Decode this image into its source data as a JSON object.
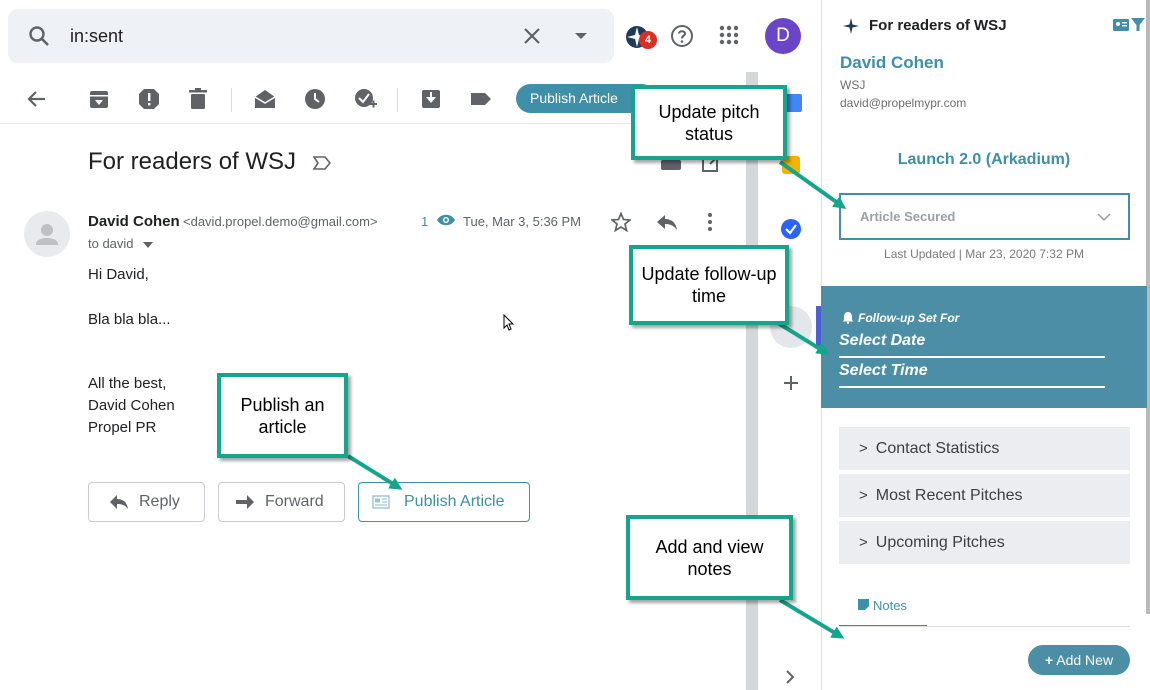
{
  "search": {
    "query": "in:sent"
  },
  "header": {
    "avatar_letter": "D",
    "notification_count": "4"
  },
  "toolbar": {
    "publish_label": "Publish Article"
  },
  "email": {
    "subject": "For readers of WSJ",
    "sender_name": "David Cohen",
    "sender_email": "<david.propel.demo@gmail.com>",
    "to": "to david",
    "view_count": "1",
    "date": "Tue, Mar 3, 5:36 PM",
    "body": [
      "Hi David,",
      "Bla bla bla...",
      "All the best,",
      "David Cohen",
      "Propel PR"
    ]
  },
  "actions": {
    "reply": "Reply",
    "forward": "Forward",
    "publish": "Publish Article"
  },
  "panel": {
    "title": "For readers of WSJ",
    "contact_name": "David Cohen",
    "contact_outlet": "WSJ",
    "contact_email": "david@propelmypr.com",
    "campaign": "Launch 2.0 (Arkadium)",
    "status": "Article Secured",
    "last_updated": "Last Updated | Mar 23, 2020 7:32 PM",
    "followup_head": "Follow-up Set For",
    "select_date": "Select Date",
    "select_time": "Select Time",
    "sections": [
      "Contact Statistics",
      "Most Recent Pitches",
      "Upcoming Pitches"
    ],
    "notes_tab": "Notes",
    "add_new": "Add New"
  },
  "callouts": {
    "pitch_status": "Update pitch status",
    "followup": "Update follow-up time",
    "publish": "Publish an article",
    "notes": "Add and view notes"
  },
  "colors": {
    "accent": "#3e8fa8",
    "callout_border": "#14a68c",
    "followup_bg": "#4b8ea5"
  }
}
